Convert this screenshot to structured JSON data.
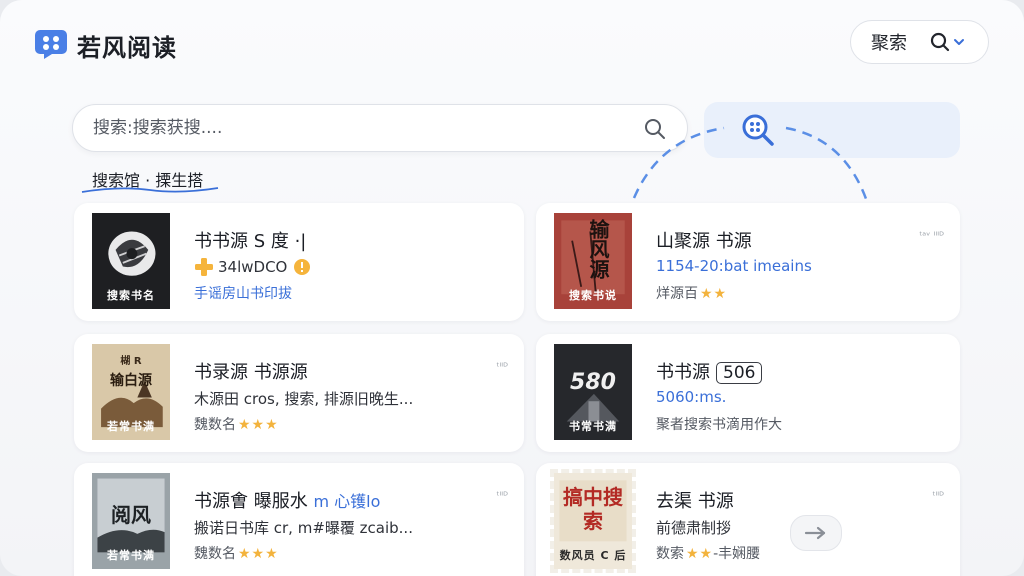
{
  "app": {
    "title": "若风阅读",
    "header_button_label": "聚索"
  },
  "search": {
    "placeholder": "搜索:搜索获搜....",
    "value": ""
  },
  "filter": {
    "label": "搜索馆 · 搮生搭"
  },
  "colors": {
    "accent": "#3a6fd8",
    "star": "#f3b33d",
    "plus": "#f5b43c"
  },
  "cards": [
    {
      "title": "书书源 S 度 ·|",
      "line2": "34lwDCO",
      "line3": "手谣房山书印拔",
      "cover_caption": "搜索书名",
      "icon": "plus-icon"
    },
    {
      "title": "山聚源 书源",
      "meta": "ᵗᵃᵛ ᴵᴵᴵᴰ",
      "line2": "1154-20:bat imeains",
      "line3": "烊源百",
      "stars": "★★",
      "cover_big": "输风源",
      "cover_caption": "搜索书说"
    },
    {
      "title": "书录源 书源源",
      "meta": "ᵗᴵᴵᴰ",
      "line2": "木源田 cros, 搜索, 排源旧晚生...",
      "line3": "魏数名",
      "stars": "★★★",
      "cover_big": "输白源",
      "cover_small": "楜 R",
      "cover_caption": "若常书满"
    },
    {
      "title": "书书源",
      "boxed": "506",
      "line2": "5060:ms.",
      "line3": "聚者搜索书滴用作大",
      "cover_big": "580",
      "cover_caption": "书常书满"
    },
    {
      "title": "书源㑹 曝服水",
      "title_suffix": "m 心镬lo",
      "meta": "ᵗᴵᴵᴰ",
      "line2": "搬诺日书库 cr, m#曝覆 zcaib...",
      "line3": "魏数名",
      "stars": "★★★",
      "cover_big": "阅风",
      "cover_caption": "若常书满"
    },
    {
      "title": "去渠 书源",
      "meta": "ᵗᴵᴵᴰ",
      "line2": "前德肃制拶",
      "line3": "数索",
      "stars": "★★",
      "line3_suffix": "-丰娴腰",
      "cover_big": "搞中搜索",
      "cover_caption": "数风员 C 后"
    }
  ]
}
